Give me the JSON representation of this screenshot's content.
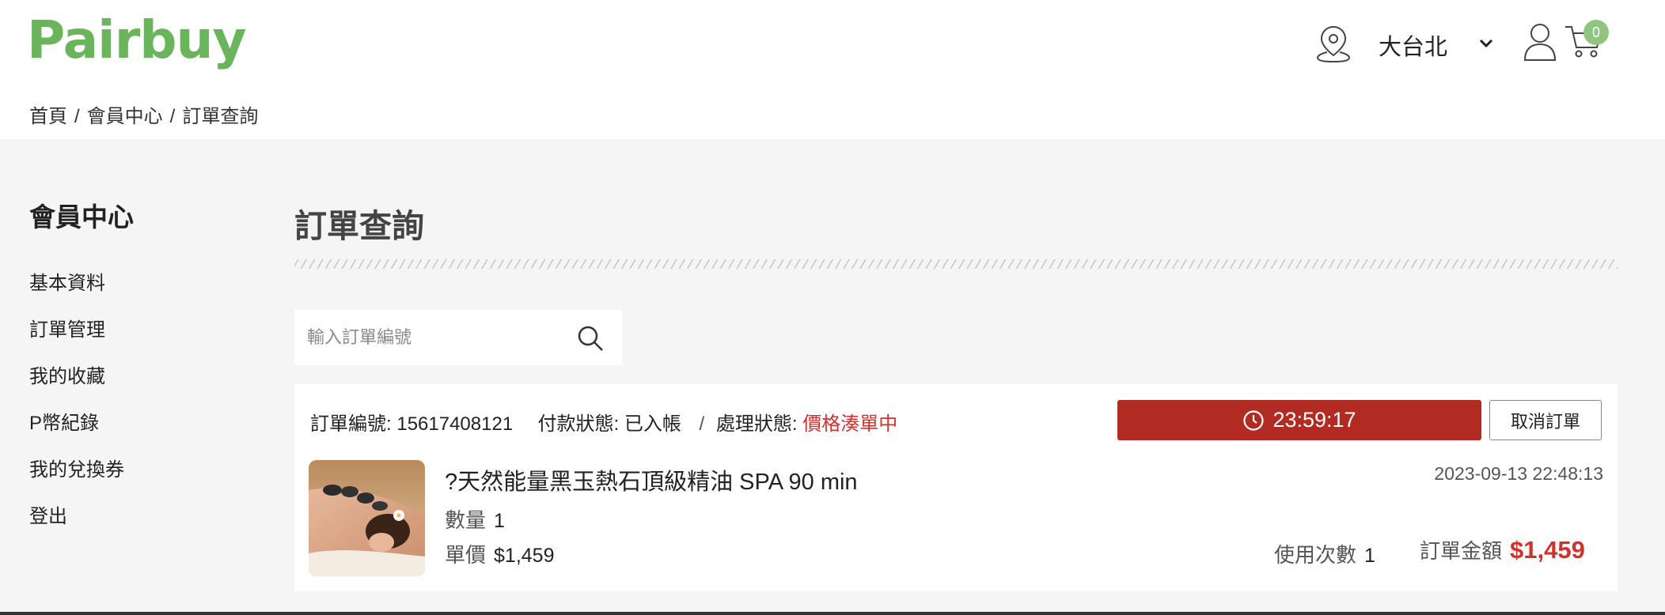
{
  "brand": {
    "logo_text": "Pairbuy",
    "color": "#6ab55b"
  },
  "header": {
    "location_icon": "map-pin-icon",
    "region": "大台北",
    "region_dropdown_icon": "chevron-down-icon",
    "account_icon": "user-icon",
    "cart_icon": "shopping-cart-icon",
    "cart_count": "0"
  },
  "breadcrumb": {
    "items": [
      "首頁",
      "會員中心",
      "訂單查詢"
    ],
    "separator": "/"
  },
  "sidebar": {
    "title": "會員中心",
    "items": [
      {
        "label": "基本資料"
      },
      {
        "label": "訂單管理"
      },
      {
        "label": "我的收藏"
      },
      {
        "label": "P幣紀錄"
      },
      {
        "label": "我的兌換券"
      },
      {
        "label": "登出"
      }
    ]
  },
  "main": {
    "title": "訂單查詢",
    "search": {
      "placeholder": "輸入訂單編號",
      "value": "",
      "icon": "search-icon"
    }
  },
  "order": {
    "number_label": "訂單編號:",
    "number": "15617408121",
    "payment_label": "付款狀態:",
    "payment_status": "已入帳",
    "process_label": "處理狀態:",
    "process_status": "價格湊單中",
    "timer": "23:59:17",
    "timer_icon": "clock-icon",
    "cancel_label": "取消訂單",
    "product_name": "?天然能量黑玉熱石頂級精油 SPA 90 min",
    "qty_label": "數量",
    "qty": "1",
    "unit_price_label": "單價",
    "unit_price": "$1,459",
    "date": "2023-09-13 22:48:13",
    "usage_label": "使用次數",
    "usage": "1",
    "total_label": "訂單金額",
    "total": "$1,459",
    "thumbnail_icon": "product-photo"
  },
  "colors": {
    "accent_red": "#b22b22",
    "status_red": "#d0312d",
    "page_bg": "#f5f5f5",
    "badge_green": "#8fc57f"
  }
}
